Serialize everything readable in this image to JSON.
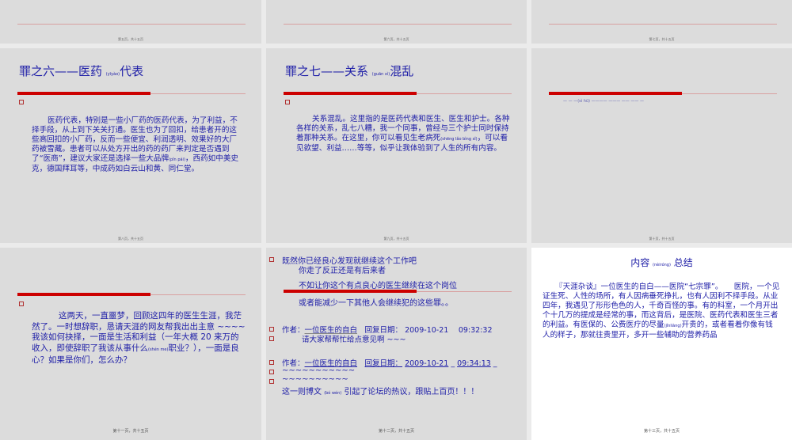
{
  "footers": [
    "第五页，共十五页",
    "第六页，共十五页",
    "第七页，共十五页",
    "第八页，共十五页",
    "第九页，共十五页",
    "第十页，共十五页",
    "第十一页，共十五页",
    "第十二页，共十五页",
    "第十三页，共十五页"
  ],
  "slide4": {
    "title_a": "罪之六——医药",
    "title_py": "(yīyào)",
    "title_b": "代表",
    "body_a": "医药代表，特别是一些小厂药的医药代表，为了利益，不择手段，从上到下关关打通。医生也为了回扣，给患者开的这些高回扣的小厂药，反而一些便宜、利润透明、效果好的大厂药被雪藏。患者可以从处方开出的药的药厂来判定是否遇到了“医商”，建议大家还是选择一些大品牌",
    "body_py": "(pǐn pái)",
    "body_b": "，西药如中美史克，德国拜耳等，中成药如白云山和黄、同仁堂。"
  },
  "slide5": {
    "title_a": "罪之七——关系",
    "title_py": "(guān xì)",
    "title_b": "混乱",
    "body_a": "关系混乱。这里指的是医药代表和医生、医生和护士。各种各样的关系，乱七八糟，我一个同事，曾经与三个护士同时保持着那种关系。在这里，你可以看见生老病死",
    "body_py": "(shēng lǎo bìng sǐ)",
    "body_b": "，可以看见欲望、利益……等等，似乎让我体验到了人生的所有内容。"
  },
  "slide6": {
    "faint_text": "(sì hū)"
  },
  "slide7": {
    "body_a": "这两天，一直噩梦，回顾这四年的医生生涯，我茫然了。一时想辞职，恳请天涯的网友帮我出出主意 ~~~~ 我该如何抉择，一面是生活和利益（一年大概 20 来万的收入，即使辞职了我该从事什么",
    "body_py": "(shén me)",
    "body_b": "职业？），一面是良心？如果是你们，怎么办？"
  },
  "slide8": {
    "l1": "既然你已经良心发现就继续这个工作吧",
    "l2": "你走了反正还是有后来者",
    "l3": "不如让你这个有点良心的医生继续在这个岗位",
    "l4": "或者能减少一下其他人会继续犯的这些罪。。",
    "author_label": "作者：",
    "author": "一位医生的自白",
    "reply_label": "回复日期：",
    "date1": "2009-10-21",
    "time1": "09:32:32",
    "comment": "请大家帮帮忙给点意见啊 ~~~",
    "date2": "2009-10-21",
    "time2": "09:34:13",
    "tilde1": "~~~~~~~~~~~",
    "tilde2": "~~~~~~~~~~",
    "last_a": "这一则博文",
    "last_py": "(bó wén)",
    "last_b": "引起了论坛的热议，跟贴上百页！！！"
  },
  "slide9": {
    "title_a": "内容",
    "title_py": "(nèiróng)",
    "title_b": "总结",
    "body_a": "『天涯杂谈』一位医生的自白——医院“七宗罪”。　　医院，一个见证生死、人性的场所，有人因病垂死挣扎，也有人因利不择手段。从业四年，我遇见了形形色色的人，千奇百怪的事。有的科室，一个月开出个十几万的提成是经常的事，而这背后，是医院、医药代表和医生三者的利益。有医保的、公费医疗的尽量",
    "body_py": "(jǐnliàng)",
    "body_b": "开贵的，或者看着你像有钱人的样子，那就往贵里开，多开一些辅助的营养药品"
  }
}
